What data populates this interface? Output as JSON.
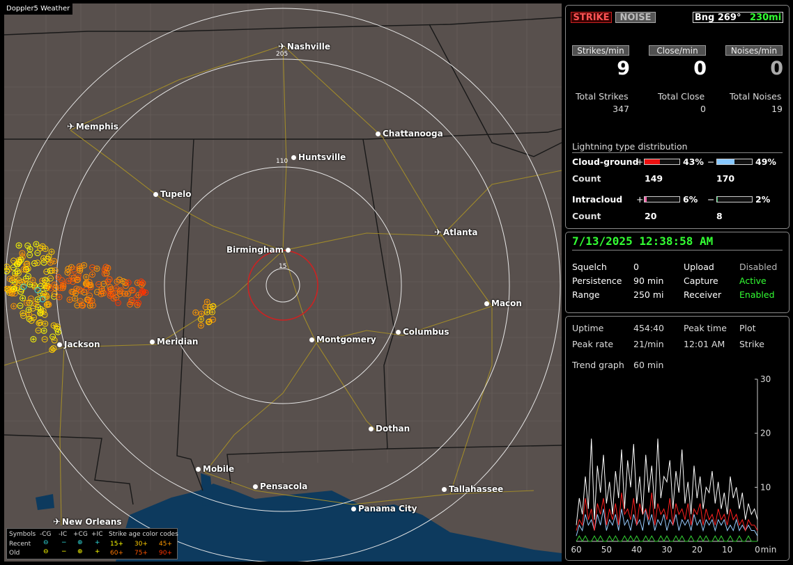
{
  "app_title": "Doppler5 Weather",
  "map": {
    "cities": [
      {
        "id": "nashville",
        "name": "Nashville",
        "type": "airport"
      },
      {
        "id": "memphis",
        "name": "Memphis",
        "type": "airport"
      },
      {
        "id": "chattanooga",
        "name": "Chattanooga",
        "type": "city"
      },
      {
        "id": "huntsville",
        "name": "Huntsville",
        "type": "city"
      },
      {
        "id": "tupelo",
        "name": "Tupelo",
        "type": "city"
      },
      {
        "id": "atlanta",
        "name": "Atlanta",
        "type": "airport"
      },
      {
        "id": "birmingham",
        "name": "Birmingham",
        "type": "city"
      },
      {
        "id": "macon",
        "name": "Macon",
        "type": "city"
      },
      {
        "id": "jackson",
        "name": "Jackson",
        "type": "city"
      },
      {
        "id": "meridian",
        "name": "Meridian",
        "type": "city"
      },
      {
        "id": "montgomery",
        "name": "Montgomery",
        "type": "city"
      },
      {
        "id": "columbus",
        "name": "Columbus",
        "type": "city"
      },
      {
        "id": "dothan",
        "name": "Dothan",
        "type": "city"
      },
      {
        "id": "mobile",
        "name": "Mobile",
        "type": "city"
      },
      {
        "id": "pensacola",
        "name": "Pensacola",
        "type": "city"
      },
      {
        "id": "tallahassee",
        "name": "Tallahassee",
        "type": "city"
      },
      {
        "id": "panama_city",
        "name": "Panama City",
        "type": "city"
      },
      {
        "id": "new_orleans",
        "name": "New Orleans",
        "type": "airport"
      }
    ],
    "range_rings": [
      "205",
      "110",
      "15"
    ],
    "colors": {
      "land": "#58504d",
      "water": "#0d3a5e",
      "roads": "#a08a2a",
      "borders": "#1a1a1a",
      "rings": "#e8e8e8",
      "close_ring": "#cc2222"
    }
  },
  "legend": {
    "symbols_label": "Symbols",
    "neg_cg": "-CG",
    "neg_ic": "-IC",
    "pos_cg": "+CG",
    "pos_ic": "+IC",
    "age_title": "Strike age color codes",
    "recent": "Recent",
    "old": "Old",
    "ages_recent": [
      "15+",
      "30+",
      "45+"
    ],
    "ages_old": [
      "60+",
      "75+",
      "90+"
    ],
    "age_colors": [
      "#ffff00",
      "#ffcc00",
      "#ff9900",
      "#ff7700",
      "#ff5500",
      "#ff3300"
    ]
  },
  "status": {
    "strike_btn": "STRIKE",
    "noise_btn": "NOISE",
    "bearing": "Bng 269°",
    "distance": "230mi",
    "strikes_per_min_label": "Strikes/min",
    "close_per_min_label": "Close/min",
    "noises_per_min_label": "Noises/min",
    "strikes_per_min": "9",
    "close_per_min": "0",
    "noises_per_min": "0",
    "total_strikes_label": "Total Strikes",
    "total_close_label": "Total Close",
    "total_noises_label": "Total Noises",
    "total_strikes": "347",
    "total_close": "0",
    "total_noises": "19",
    "distribution_title": "Lightning type distribution",
    "cloud_ground_label": "Cloud-ground",
    "intracloud_label": "Intracloud",
    "count_label": "Count",
    "plus": "+",
    "minus": "−",
    "cg_pos_pct": "43%",
    "cg_neg_pct": "49%",
    "cg_pos_count": "149",
    "cg_neg_count": "170",
    "ic_pos_pct": "6%",
    "ic_neg_pct": "2%",
    "ic_pos_count": "20",
    "ic_neg_count": "8",
    "cg_pos_fraction": 0.43,
    "cg_neg_fraction": 0.49,
    "ic_pos_fraction": 0.06,
    "ic_neg_fraction": 0.02
  },
  "settings": {
    "datetime": "7/13/2025 12:38:58 AM",
    "squelch_label": "Squelch",
    "squelch": "0",
    "persistence_label": "Persistence",
    "persistence": "90 min",
    "range_label": "Range",
    "range": "250 mi",
    "upload_label": "Upload",
    "upload": "Disabled",
    "capture_label": "Capture",
    "capture": "Active",
    "receiver_label": "Receiver",
    "receiver": "Enabled"
  },
  "trend": {
    "uptime_label": "Uptime",
    "uptime": "454:40",
    "peak_time_label": "Peak time",
    "peak_time": "12:01 AM",
    "plot_label": "Plot",
    "plot": "Strike",
    "peak_rate_label": "Peak rate",
    "peak_rate": "21/min",
    "trend_graph_label": "Trend graph",
    "trend_graph": "60 min",
    "y_ticks": [
      "30",
      "20",
      "10"
    ],
    "x_ticks": [
      "60",
      "50",
      "40",
      "30",
      "20",
      "10",
      "0"
    ],
    "x_unit": "min"
  },
  "chart_data": {
    "type": "line",
    "title": "",
    "xlabel": "min",
    "ylabel": "",
    "xlim": [
      60,
      0
    ],
    "ylim": [
      0,
      30
    ],
    "x": [
      60,
      59,
      58,
      57,
      56,
      55,
      54,
      53,
      52,
      51,
      50,
      49,
      48,
      47,
      46,
      45,
      44,
      43,
      42,
      41,
      40,
      39,
      38,
      37,
      36,
      35,
      34,
      33,
      32,
      31,
      30,
      29,
      28,
      27,
      26,
      25,
      24,
      23,
      22,
      21,
      20,
      19,
      18,
      17,
      16,
      15,
      14,
      13,
      12,
      11,
      10,
      9,
      8,
      7,
      6,
      5,
      4,
      3,
      2,
      1,
      0
    ],
    "series": [
      {
        "color": "#ffffff",
        "values": [
          3,
          8,
          5,
          12,
          6,
          19,
          4,
          14,
          9,
          16,
          7,
          11,
          5,
          13,
          8,
          17,
          6,
          15,
          10,
          18,
          7,
          12,
          5,
          16,
          9,
          14,
          6,
          19,
          8,
          12,
          11,
          15,
          6,
          13,
          9,
          17,
          7,
          11,
          5,
          14,
          8,
          12,
          6,
          10,
          9,
          13,
          7,
          11,
          6,
          9,
          5,
          12,
          8,
          10,
          6,
          9,
          4,
          7,
          5,
          6,
          4
        ]
      },
      {
        "color": "#ff2020",
        "values": [
          2,
          4,
          3,
          8,
          4,
          6,
          2,
          7,
          5,
          8,
          3,
          6,
          4,
          7,
          3,
          9,
          5,
          6,
          4,
          8,
          3,
          7,
          5,
          6,
          4,
          9,
          3,
          7,
          5,
          6,
          4,
          8,
          3,
          7,
          5,
          6,
          4,
          7,
          3,
          6,
          5,
          7,
          3,
          6,
          4,
          5,
          3,
          6,
          4,
          5,
          3,
          6,
          4,
          5,
          3,
          4,
          2,
          4,
          3,
          3,
          2
        ]
      },
      {
        "color": "#99ccff",
        "values": [
          1,
          3,
          2,
          5,
          3,
          4,
          2,
          5,
          3,
          6,
          2,
          4,
          3,
          5,
          2,
          6,
          3,
          4,
          2,
          5,
          3,
          4,
          2,
          6,
          3,
          5,
          2,
          4,
          3,
          5,
          2,
          4,
          3,
          5,
          2,
          4,
          3,
          4,
          2,
          5,
          3,
          4,
          2,
          4,
          3,
          4,
          2,
          4,
          3,
          4,
          2,
          3,
          2,
          4,
          2,
          3,
          2,
          3,
          2,
          2,
          1
        ]
      },
      {
        "color": "#33cc33",
        "values": [
          0,
          1,
          0,
          1,
          0,
          0,
          1,
          0,
          1,
          0,
          0,
          1,
          0,
          1,
          0,
          0,
          1,
          0,
          1,
          0,
          1,
          0,
          0,
          1,
          0,
          1,
          0,
          0,
          1,
          0,
          1,
          0,
          0,
          1,
          0,
          1,
          0,
          0,
          1,
          0,
          0,
          1,
          0,
          1,
          0,
          0,
          1,
          0,
          1,
          0,
          0,
          1,
          0,
          0,
          1,
          0,
          0,
          1,
          0,
          0,
          0
        ]
      }
    ]
  }
}
